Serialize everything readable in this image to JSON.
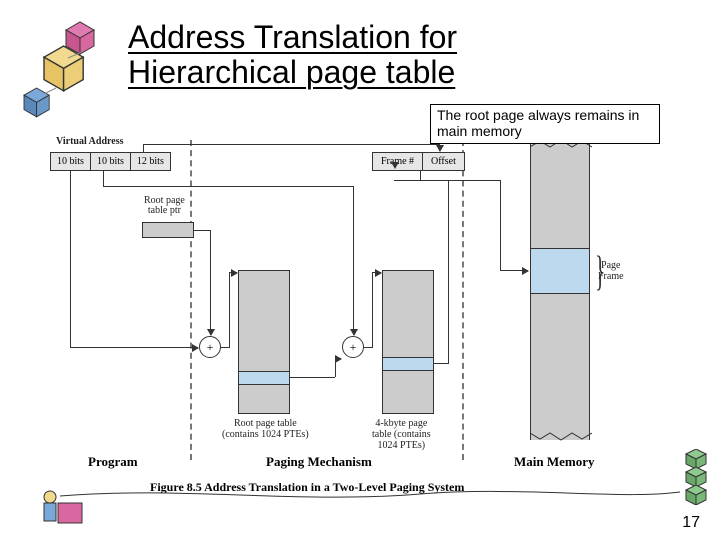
{
  "title_line1": "Address Translation for",
  "title_line2": "Hierarchical page table",
  "note": "The root page always remains in main memory",
  "page_number": "17",
  "diagram": {
    "va_label": "Virtual Address",
    "va_fields": {
      "f1": "10 bits",
      "f2": "10 bits",
      "f3": "12 bits"
    },
    "frame_fields": {
      "f1": "Frame #",
      "f2": "Offset"
    },
    "root_ptr_label_l1": "Root page",
    "root_ptr_label_l2": "table ptr",
    "plus": "+",
    "root_table_caption_l1": "Root page table",
    "root_table_caption_l2": "(contains 1024 PTEs)",
    "leaf_table_caption_l1": "4-kbyte page",
    "leaf_table_caption_l2": "table (contains",
    "leaf_table_caption_l3": "1024 PTEs)",
    "page_frame_label_l1": "Page",
    "page_frame_label_l2": "Frame",
    "sections": {
      "program": "Program",
      "paging": "Paging Mechanism",
      "memory": "Main Memory"
    },
    "caption": "Figure 8.5   Address Translation in a Two-Level Paging System"
  }
}
